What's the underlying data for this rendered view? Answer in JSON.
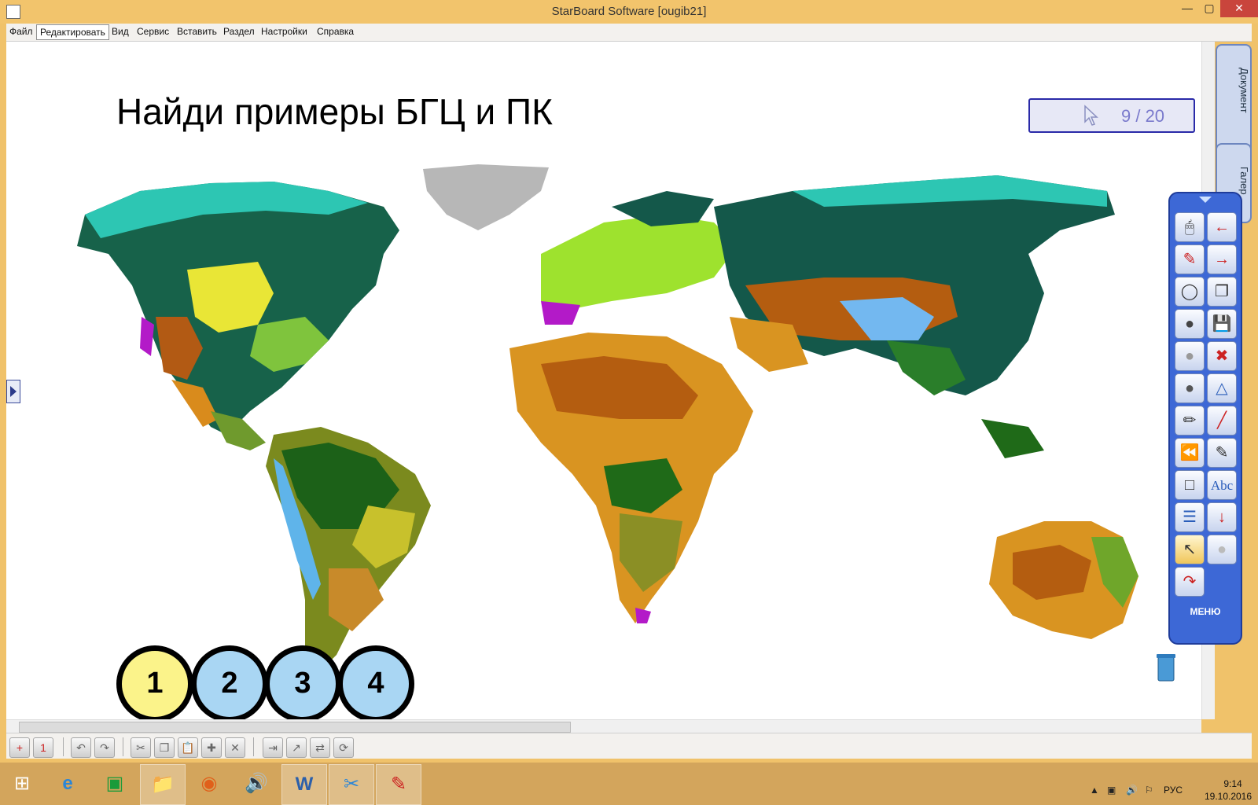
{
  "window": {
    "title": "StarBoard Software [ougib21]"
  },
  "menu": [
    "Файл",
    "Редактировать",
    "Вид",
    "Сервис",
    "Вставить",
    "Раздел",
    "Настройки",
    "Справка"
  ],
  "slide": {
    "title": "Найди примеры БГЦ и ПК",
    "page": "9 / 20",
    "answers": [
      {
        "label": "1",
        "color": "#fbf38a"
      },
      {
        "label": "2",
        "color": "#a9d6f3"
      },
      {
        "label": "3",
        "color": "#a9d6f3"
      },
      {
        "label": "4",
        "color": "#a9d6f3"
      }
    ]
  },
  "side_tabs": {
    "document": "Документ",
    "gallery": "Галер"
  },
  "toolbox": {
    "tools": [
      "mouse-icon",
      "arrow-left-icon",
      "pen-icon",
      "arrow-right-icon",
      "circle-hollow-icon",
      "pages-icon",
      "circle-dark-icon",
      "save-icon",
      "circle-grey-icon",
      "delete-page-icon",
      "circle-dark2-icon",
      "shapes-icon",
      "highlighter-icon",
      "line-icon",
      "rewind-icon",
      "marker-icon",
      "whiteboard-icon",
      "text-icon",
      "layers-icon",
      "import-icon",
      "pointer-icon",
      "eraser-icon",
      "export-icon"
    ],
    "menu_label": "МЕНЮ"
  },
  "taskbar": {
    "apps": [
      "start-icon",
      "internet-explorer-icon",
      "store-icon",
      "file-explorer-icon",
      "firefox-icon",
      "sound-icon",
      "word-icon",
      "snipping-icon",
      "starboard-icon"
    ],
    "lang": "РУС",
    "time": "9:14",
    "date": "19.10.2016"
  }
}
